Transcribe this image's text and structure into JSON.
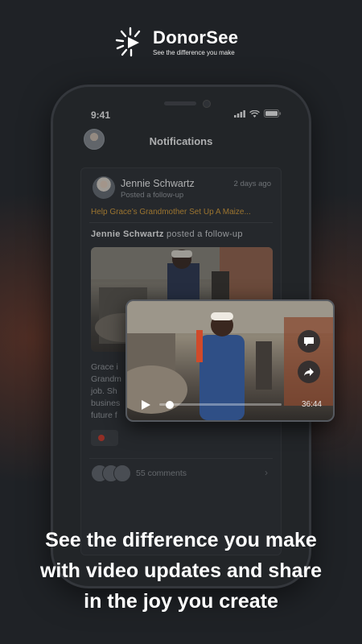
{
  "brand": {
    "name": "DonorSee",
    "tagline": "See the difference you make"
  },
  "status_bar": {
    "time": "9:41"
  },
  "nav": {
    "title": "Notifications"
  },
  "notification": {
    "author": "Jennie Schwartz",
    "subtitle": "Posted a follow-up",
    "time": "2 days ago",
    "project_link": "Help Grace’s Grandmother Set Up A Maize...",
    "headline_author": "Jennie Schwartz",
    "headline_action": " posted a follow-up",
    "body_lines": [
      "Grace i",
      "Grandm",
      "job. Sh",
      "busines",
      "future f"
    ],
    "comments_label": "55 comments"
  },
  "video": {
    "duration": "36:44",
    "progress_fraction": 0.05
  },
  "headline": {
    "lines": [
      "See the difference you make",
      "with video updates and share",
      "in the joy you create"
    ]
  },
  "colors": {
    "background": "#1f2226",
    "accent_link": "#e2a53b",
    "like_red": "#d63b2c"
  },
  "icons": [
    "donorsee-logo-icon",
    "signal-icon",
    "wifi-icon",
    "battery-icon",
    "chat-bubble-icon",
    "share-arrow-icon",
    "play-icon",
    "chevron-right-icon"
  ]
}
